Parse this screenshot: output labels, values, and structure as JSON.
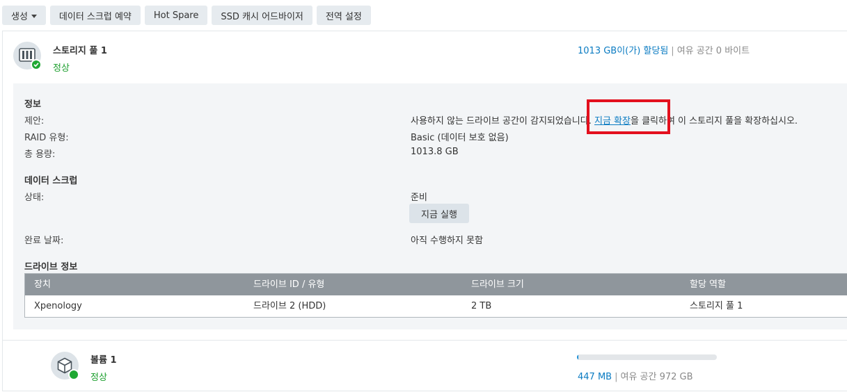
{
  "toolbar": {
    "create_label": "생성",
    "scrub_schedule_label": "데이터 스크럽 예약",
    "hot_spare_label": "Hot Spare",
    "ssd_cache_label": "SSD 캐시 어드바이저",
    "global_settings_label": "전역 설정"
  },
  "pool": {
    "name": "스토리지 풀 1",
    "status": "정상",
    "allocated": "1013 GB이(가) 할당됨",
    "separator": "|",
    "free": "여유 공간 0 바이트",
    "icon": "storage-drive-icon",
    "status_icon": "check-circle-icon"
  },
  "info": {
    "title": "정보",
    "suggestion_label": "제안:",
    "suggestion_pre": "사용하지 않는 드라이브 공간이 감지되었습니다. ",
    "suggestion_link": "지금 확장",
    "suggestion_post": "을 클릭하여 이 스토리지 풀을 확장하십시오.",
    "raid_label": "RAID 유형:",
    "raid_value": "Basic (데이터 보호 없음)",
    "capacity_label": "총 용량:",
    "capacity_value": "1013.8 GB"
  },
  "scrub": {
    "title": "데이터 스크럽",
    "status_label": "상태:",
    "status_value": "준비",
    "run_now_label": "지금 실행",
    "completed_label": "완료 날짜:",
    "completed_value": "아직 수행하지 못함"
  },
  "drives": {
    "title": "드라이브 정보",
    "columns": [
      "장치",
      "드라이브 ID / 유형",
      "드라이브 크기",
      "할당 역할"
    ],
    "rows": [
      [
        "Xpenology",
        "드라이브 2 (HDD)",
        "2 TB",
        "스토리지 풀 1"
      ]
    ]
  },
  "volume": {
    "name": "볼륨 1",
    "status": "정상",
    "used": "447 MB",
    "separator": "|",
    "free": "여유 공간 972 GB",
    "usage_fraction": 0.0005,
    "icon": "volume-cube-icon"
  },
  "colors": {
    "accent": "#0a7bc2",
    "ok": "#1a9e2c",
    "highlight": "#e3101e"
  }
}
